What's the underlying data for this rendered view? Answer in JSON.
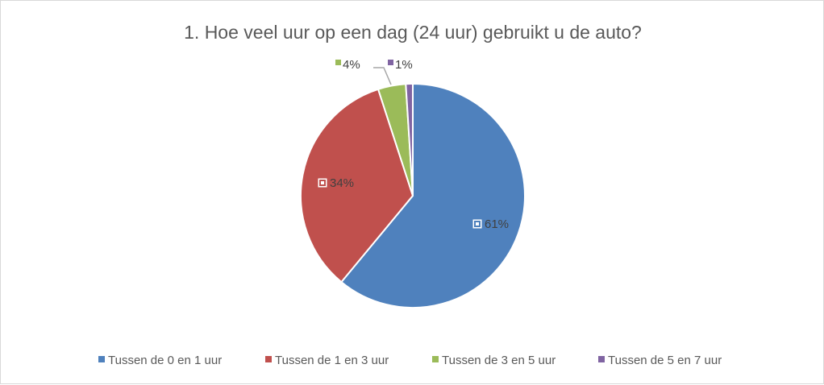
{
  "chart_data": {
    "type": "pie",
    "title": "1. Hoe veel uur op een dag (24 uur) gebruikt u de auto?",
    "categories": [
      "Tussen de 0 en 1 uur",
      "Tussen de 1 en 3 uur",
      "Tussen de 3 en 5 uur",
      "Tussen de 5 en 7 uur"
    ],
    "values": [
      61,
      34,
      4,
      1
    ],
    "data_labels": [
      "61%",
      "34%",
      "4%",
      "1%"
    ],
    "colors": [
      "#4f81bd",
      "#c0504d",
      "#9bbb59",
      "#8064a2"
    ],
    "start_angle": "top, clockwise",
    "legend": "bottom"
  }
}
